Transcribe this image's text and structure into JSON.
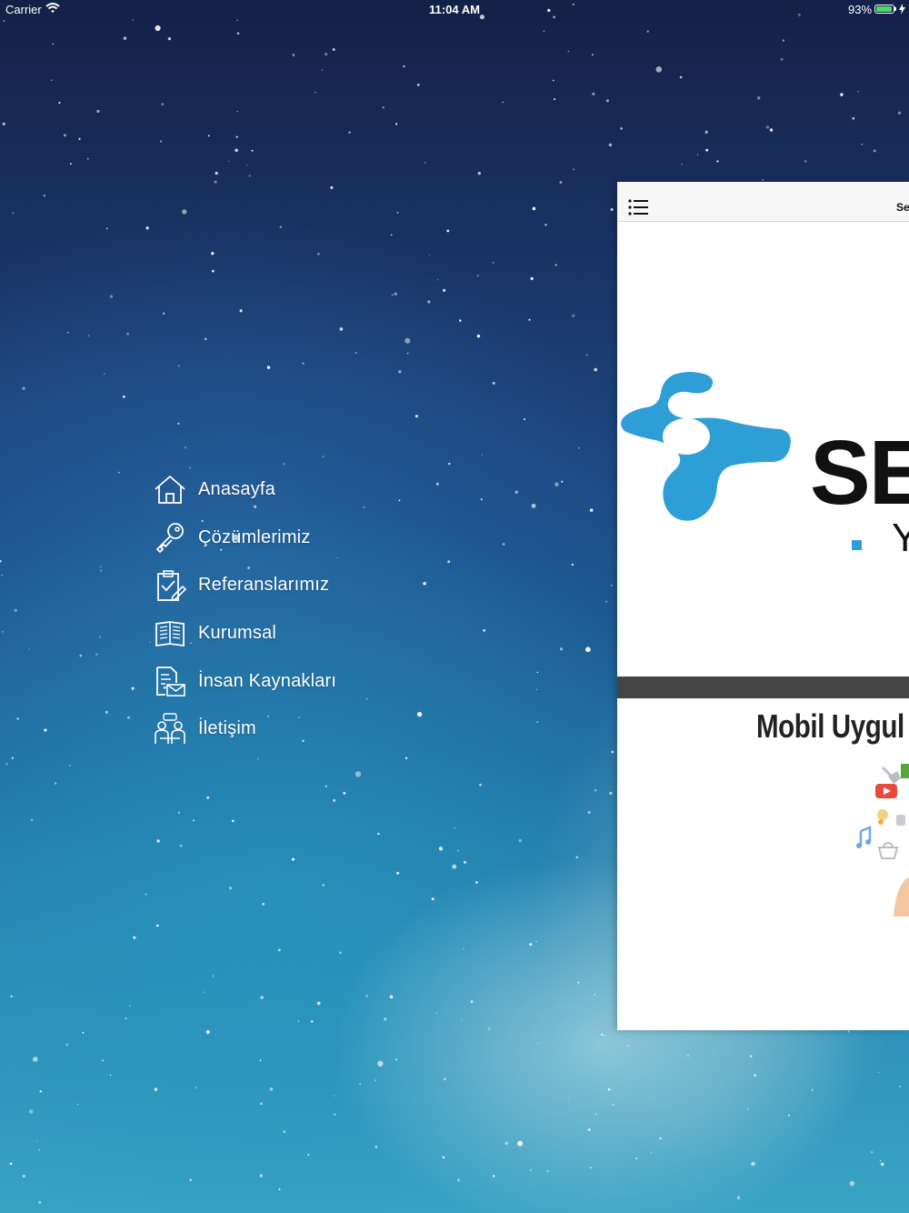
{
  "status_bar": {
    "carrier": "Carrier",
    "time": "11:04 AM",
    "battery_percent": "93%",
    "battery_level": 0.93
  },
  "menu": {
    "items": [
      {
        "label": "Anasayfa",
        "icon": "home-icon"
      },
      {
        "label": "Çözümlerimiz",
        "icon": "key-icon"
      },
      {
        "label": "Referanslarımız",
        "icon": "clipboard-check-icon"
      },
      {
        "label": "Kurumsal",
        "icon": "book-icon"
      },
      {
        "label": "İnsan Kaynakları",
        "icon": "document-mail-icon"
      },
      {
        "label": "İletişim",
        "icon": "people-icon"
      }
    ]
  },
  "content": {
    "nav_title": "Se",
    "brand_text": "SE",
    "brand_sub": "Y",
    "slide_title": "Mobil Uygul"
  },
  "colors": {
    "brand_blue": "#2e9fd6",
    "menu_text": "#ffffff",
    "band": "#454545"
  }
}
